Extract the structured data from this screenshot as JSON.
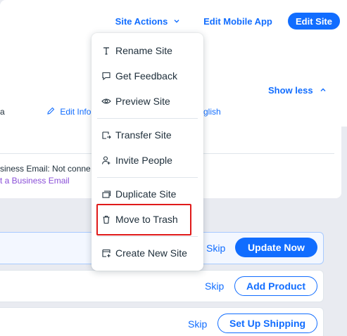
{
  "header": {
    "site_actions_label": "Site Actions",
    "edit_mobile_label": "Edit Mobile App",
    "edit_site_label": "Edit Site"
  },
  "info_card": {
    "show_less_label": "Show less",
    "left_fragment": "a",
    "edit_info_label": "Edit Info",
    "right_fragment": "glish",
    "business_email_text": "siness Email: Not conne",
    "business_email_link": "t a Business Email"
  },
  "tasks": [
    {
      "skip_label": "Skip",
      "action_label": "Update Now"
    },
    {
      "skip_label": "Skip",
      "action_label": "Add Product"
    },
    {
      "skip_label": "Skip",
      "action_label": "Set Up Shipping"
    }
  ],
  "menu": {
    "items": [
      {
        "label": "Rename Site",
        "icon": "text-icon"
      },
      {
        "label": "Get Feedback",
        "icon": "chat-bubble-icon"
      },
      {
        "label": "Preview Site",
        "icon": "eye-icon"
      },
      {
        "label": "Transfer Site",
        "icon": "transfer-icon"
      },
      {
        "label": "Invite People",
        "icon": "add-person-icon"
      },
      {
        "label": "Duplicate Site",
        "icon": "duplicate-icon"
      },
      {
        "label": "Move to Trash",
        "icon": "trash-icon"
      },
      {
        "label": "Create New Site",
        "icon": "new-site-icon"
      }
    ]
  },
  "colors": {
    "accent": "#116dff",
    "highlight": "#e01a1a",
    "background": "#e9ebf1"
  }
}
